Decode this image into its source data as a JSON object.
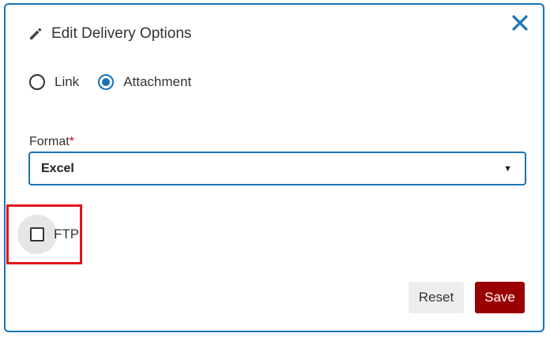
{
  "dialog": {
    "title": "Edit Delivery Options",
    "icons": {
      "title_icon": "pencil-icon",
      "close_icon": "close-icon"
    },
    "colors": {
      "accent": "#1a73b8",
      "save_bg": "#9b0000",
      "highlight": "#e3141a",
      "required": "#d0021b"
    }
  },
  "delivery_method": {
    "options": [
      {
        "label": "Link",
        "selected": false
      },
      {
        "label": "Attachment",
        "selected": true
      }
    ]
  },
  "format": {
    "label": "Format",
    "required_mark": "*",
    "value": "Excel"
  },
  "ftp": {
    "label": "FTP",
    "checked": false
  },
  "buttons": {
    "reset_label": "Reset",
    "save_label": "Save"
  }
}
